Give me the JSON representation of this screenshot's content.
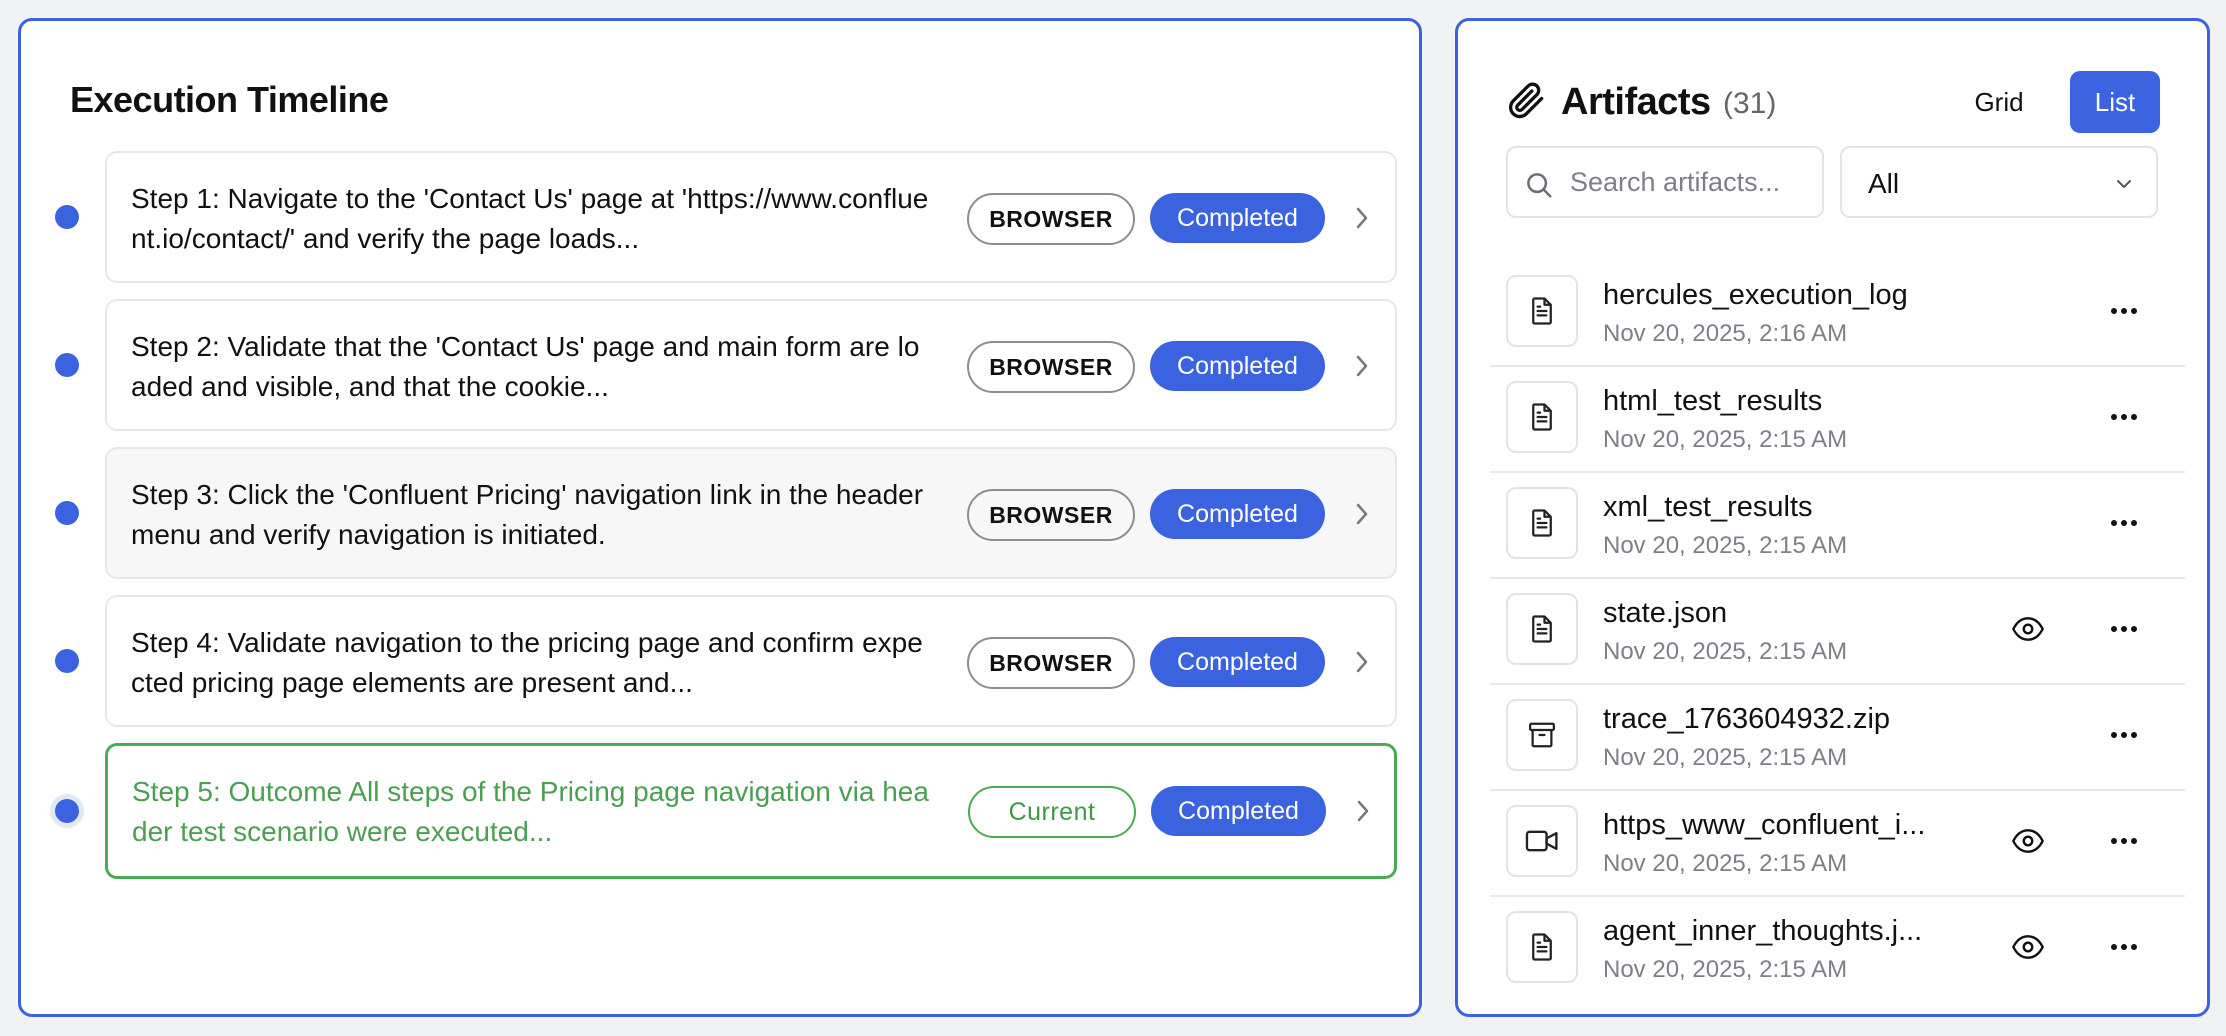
{
  "timeline": {
    "title": "Execution Timeline",
    "steps": [
      {
        "text": "Step 1: Navigate to the 'Contact Us' page at 'https://www.confluent.io/contact/' and verify the page loads...",
        "type": "BROWSER",
        "status": "Completed"
      },
      {
        "text": "Step 2: Validate that the 'Contact Us' page and main form are loaded and visible, and that the cookie...",
        "type": "BROWSER",
        "status": "Completed"
      },
      {
        "text": "Step 3: Click the 'Confluent Pricing' navigation link in the header menu and verify navigation is initiated.",
        "type": "BROWSER",
        "status": "Completed"
      },
      {
        "text": "Step 4: Validate navigation to the pricing page and confirm expected pricing page elements are present and...",
        "type": "BROWSER",
        "status": "Completed"
      },
      {
        "text": "Step 5: Outcome All steps of the Pricing page navigation via header test scenario were executed...",
        "type": "Current",
        "status": "Completed"
      }
    ]
  },
  "artifacts": {
    "title": "Artifacts",
    "count": "(31)",
    "grid_label": "Grid",
    "list_label": "List",
    "search_placeholder": "Search artifacts...",
    "filter_value": "All",
    "items": [
      {
        "name": "hercules_execution_log",
        "date": "Nov 20, 2025, 2:16 AM",
        "icon": "document-icon",
        "preview": false
      },
      {
        "name": "html_test_results",
        "date": "Nov 20, 2025, 2:15 AM",
        "icon": "document-icon",
        "preview": false
      },
      {
        "name": "xml_test_results",
        "date": "Nov 20, 2025, 2:15 AM",
        "icon": "document-icon",
        "preview": false
      },
      {
        "name": "state.json",
        "date": "Nov 20, 2025, 2:15 AM",
        "icon": "document-icon",
        "preview": true
      },
      {
        "name": "trace_1763604932.zip",
        "date": "Nov 20, 2025, 2:15 AM",
        "icon": "archive-icon",
        "preview": false
      },
      {
        "name": "https_www_confluent_i...",
        "date": "Nov 20, 2025, 2:15 AM",
        "icon": "video-icon",
        "preview": true
      },
      {
        "name": "agent_inner_thoughts.j...",
        "date": "Nov 20, 2025, 2:15 AM",
        "icon": "document-icon",
        "preview": true
      }
    ]
  },
  "colors": {
    "accent": "#3b63e0",
    "current": "#4caa55",
    "muted": "#7d8088"
  }
}
